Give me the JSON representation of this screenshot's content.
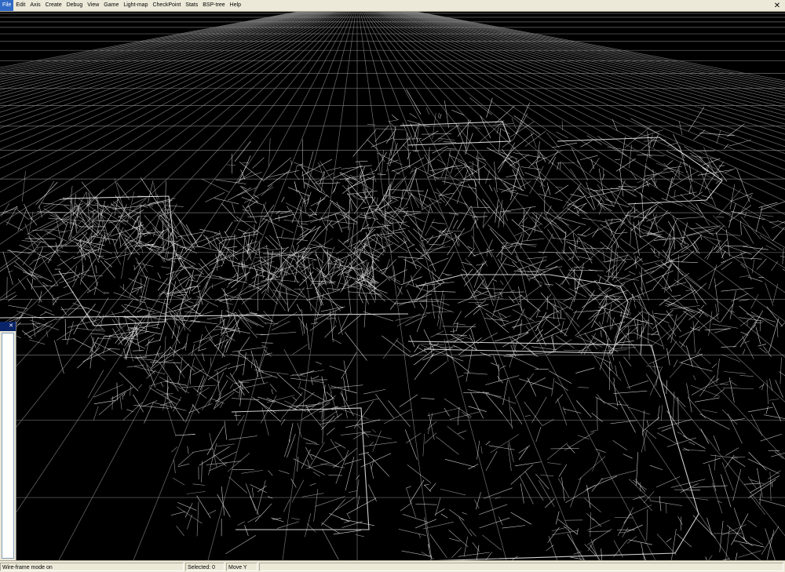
{
  "menu": {
    "items": [
      "File",
      "Edit",
      "Axis",
      "Create",
      "Debug",
      "View",
      "Game",
      "Light-map",
      "CheckPoint",
      "Stats",
      "BSP-tree",
      "Help"
    ],
    "close_glyph": "✕"
  },
  "viewport": {
    "mode": "wireframe",
    "background_color": "#000000",
    "grid_color": "#8a8a8a",
    "wire_color": "#e8e8e8"
  },
  "side_panel": {
    "close_glyph": "✕"
  },
  "statusbar": {
    "message": "Wire-frame mode on",
    "selected": "Selected: 0",
    "mode": "Move Y"
  }
}
